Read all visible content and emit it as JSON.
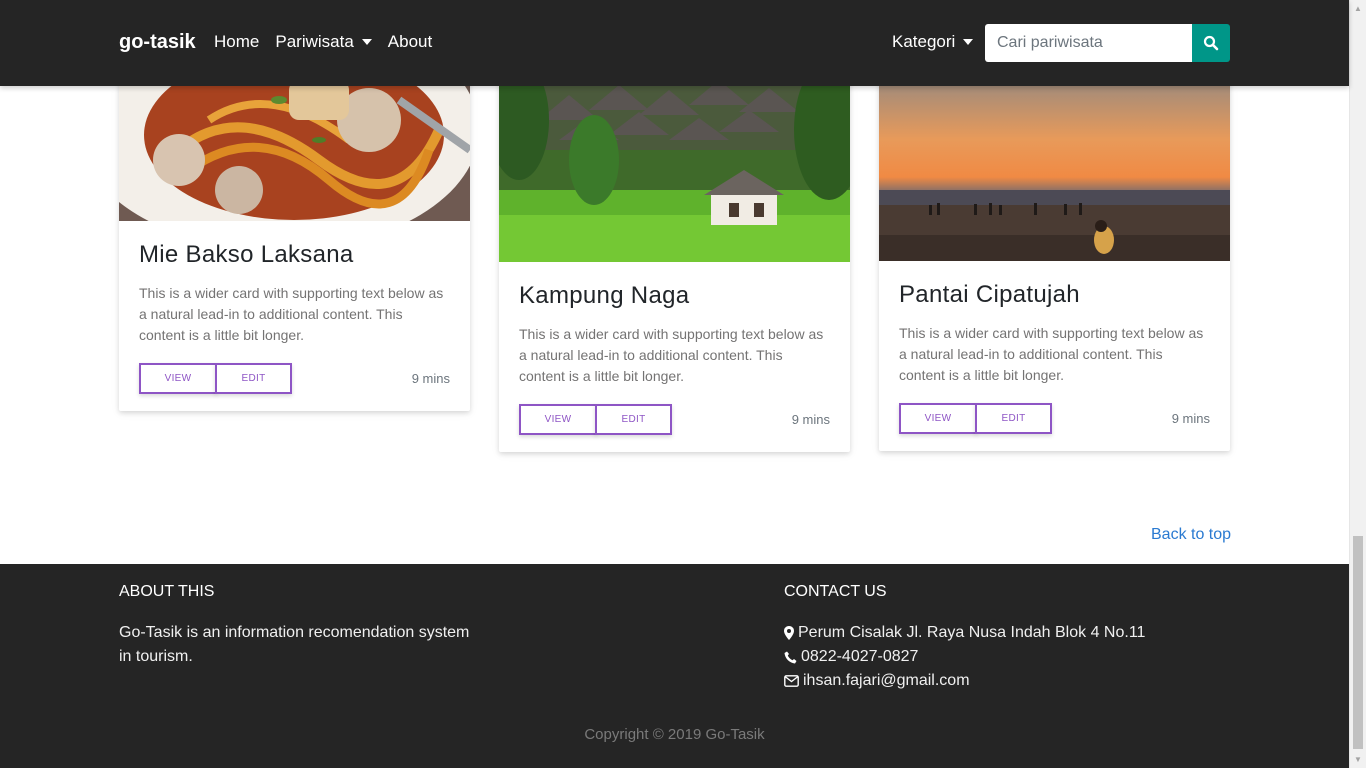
{
  "navbar": {
    "brand": "go-tasik",
    "links": [
      {
        "label": "Home"
      },
      {
        "label": "Pariwisata"
      },
      {
        "label": "About"
      }
    ],
    "kategori_label": "Kategori",
    "search_placeholder": "Cari pariwisata"
  },
  "cards": [
    {
      "title": "Mie Bakso Laksana",
      "text": "This is a wider card with supporting text below as a natural lead-in to additional content. This content is a little bit longer.",
      "view_label": "VIEW",
      "edit_label": "EDIT",
      "time": "9 mins"
    },
    {
      "title": "Kampung Naga",
      "text": "This is a wider card with supporting text below as a natural lead-in to additional content. This content is a little bit longer.",
      "view_label": "VIEW",
      "edit_label": "EDIT",
      "time": "9 mins"
    },
    {
      "title": "Pantai Cipatujah",
      "text": "This is a wider card with supporting text below as a natural lead-in to additional content. This content is a little bit longer.",
      "view_label": "VIEW",
      "edit_label": "EDIT",
      "time": "9 mins"
    }
  ],
  "back_to_top": "Back to top",
  "footer": {
    "about_title": "ABOUT THIS",
    "about_text": "Go-Tasik is an information recomendation system in tourism.",
    "contact_title": "CONTACT US",
    "address": "Perum Cisalak Jl. Raya Nusa Indah Blok 4 No.11",
    "phone": "0822-4027-0827",
    "email": "ihsan.fajari@gmail.com",
    "copyright": "Copyright © 2019 Go-Tasik"
  },
  "colors": {
    "navbar_bg": "#252525",
    "search_button": "#009688",
    "button_accent": "#8e55c5",
    "link": "#2a7ad1"
  },
  "icons": {
    "search": "search-icon",
    "address": "map-marker-icon",
    "phone": "phone-icon",
    "email": "envelope-icon"
  }
}
